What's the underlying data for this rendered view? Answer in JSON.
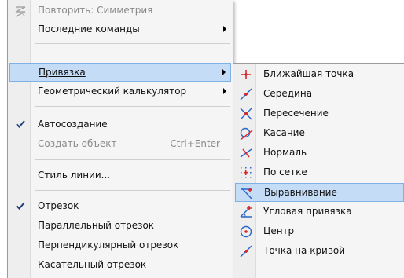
{
  "context_menu": {
    "items": [
      {
        "label": "Повторить: Симметрия",
        "state": "disabled",
        "icon": "repeat-icon"
      },
      {
        "label": "Последние команды",
        "submenu": true
      },
      {
        "label": "Привязка",
        "submenu": true,
        "highlighted": true
      },
      {
        "label": "Геометрический калькулятор",
        "submenu": true
      },
      {
        "label": "Автосоздание",
        "checked": true
      },
      {
        "label": "Создать объект",
        "state": "disabled",
        "shortcut": "Ctrl+Enter"
      },
      {
        "label": "Стиль линии..."
      },
      {
        "label": "Отрезок",
        "checked": true
      },
      {
        "label": "Параллельный отрезок"
      },
      {
        "label": "Перпендикулярный отрезок"
      },
      {
        "label": "Касательный отрезок"
      }
    ]
  },
  "snap_submenu": {
    "items": [
      {
        "label": "Ближайшая точка",
        "icon": "nearest-point-icon"
      },
      {
        "label": "Середина",
        "icon": "midpoint-icon"
      },
      {
        "label": "Пересечение",
        "icon": "intersection-icon"
      },
      {
        "label": "Касание",
        "icon": "tangent-icon"
      },
      {
        "label": "Нормаль",
        "icon": "normal-icon"
      },
      {
        "label": "По сетке",
        "icon": "grid-snap-icon"
      },
      {
        "label": "Выравнивание",
        "icon": "alignment-icon",
        "highlighted": true
      },
      {
        "label": "Угловая привязка",
        "icon": "angle-snap-icon"
      },
      {
        "label": "Центр",
        "icon": "center-icon"
      },
      {
        "label": "Точка на кривой",
        "icon": "point-on-curve-icon"
      }
    ]
  },
  "colors": {
    "highlight_fill": "#c5dcf7",
    "highlight_border": "#7fb0e6",
    "icon_red": "#d8262b",
    "icon_blue": "#2a66c9"
  }
}
